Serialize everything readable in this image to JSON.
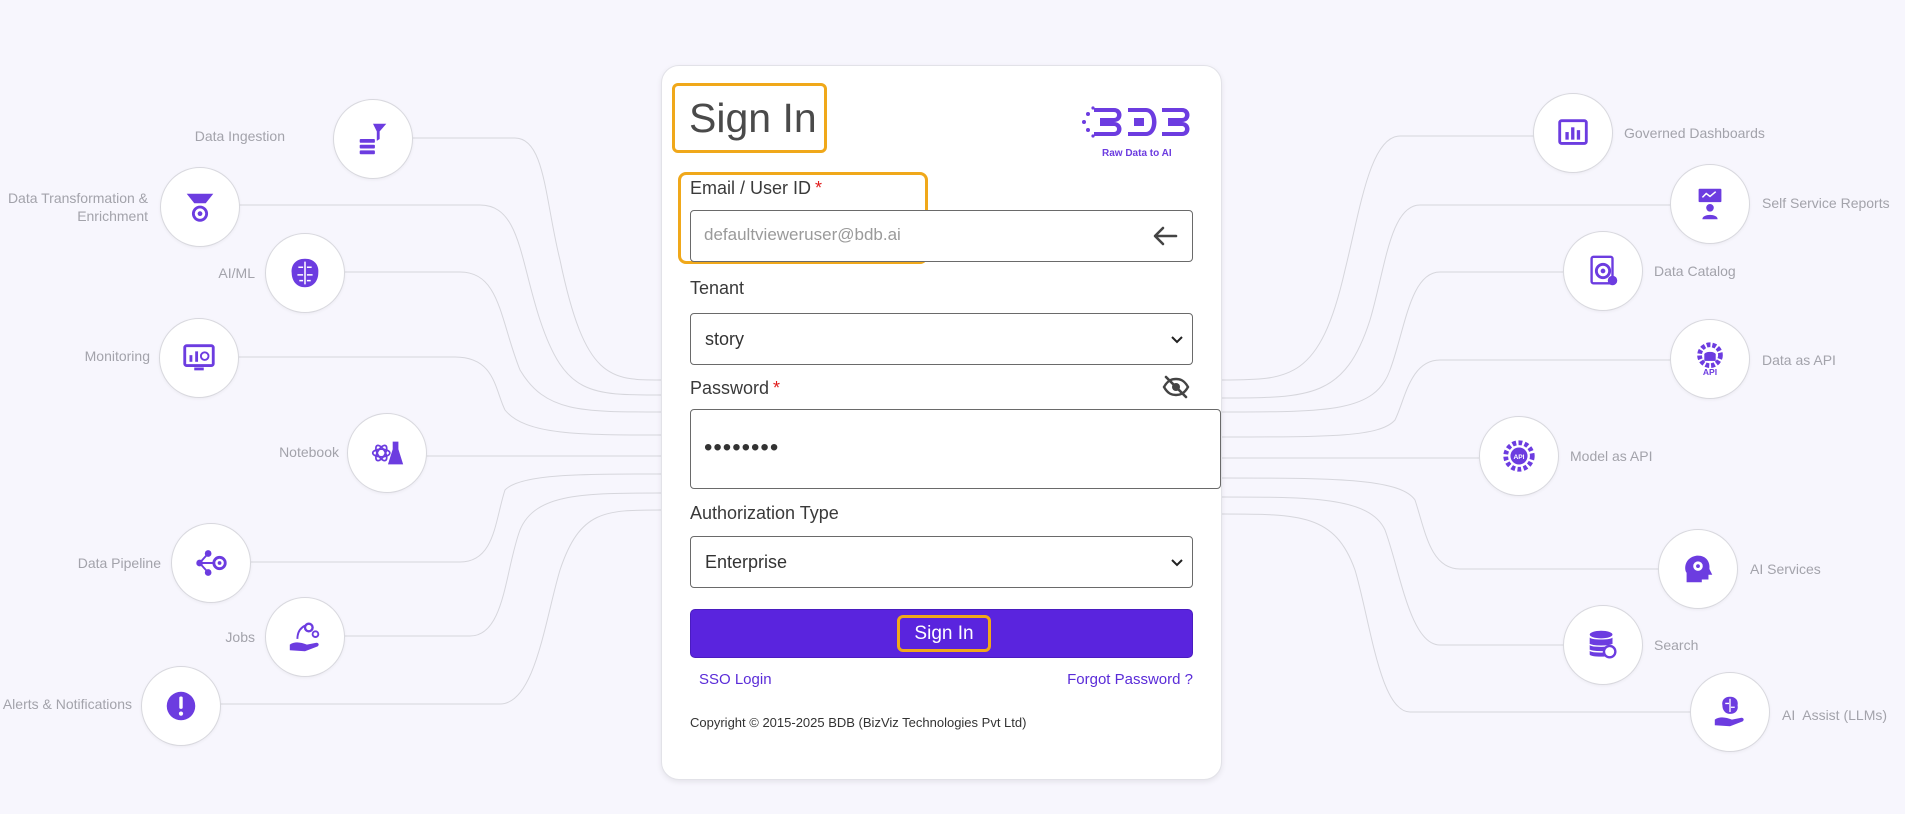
{
  "form": {
    "title": "Sign In",
    "logo_tagline": "Raw Data to AI",
    "email_label": "Email / User ID",
    "required_mark": "*",
    "email_value": "defaultvieweruser@bdb.ai",
    "tenant_label": "Tenant",
    "tenant_value": "story",
    "password_label": "Password",
    "password_value": "••••••••",
    "auth_label": "Authorization Type",
    "auth_value": "Enterprise",
    "signin_label": "Sign In",
    "sso_label": "SSO Login",
    "forgot_label": "Forgot Password ?",
    "copyright": "Copyright © 2015-2025 BDB (BizViz Technologies Pvt Ltd)"
  },
  "left_features": [
    {
      "label": "Data Ingestion",
      "icon": "funnel-database-icon"
    },
    {
      "label": "Data Transformation &",
      "label2": "Enrichment",
      "icon": "filter-gear-icon"
    },
    {
      "label": "AI/ML",
      "icon": "brain-circuit-icon"
    },
    {
      "label": "Monitoring",
      "icon": "monitor-chart-icon"
    },
    {
      "label": "Notebook",
      "icon": "atom-flask-icon"
    },
    {
      "label": "Data Pipeline",
      "icon": "pipeline-gear-icon"
    },
    {
      "label": "Jobs",
      "icon": "hand-gears-icon"
    },
    {
      "label": "Alerts & Notifications",
      "icon": "alert-icon"
    }
  ],
  "right_features": [
    {
      "label": "Governed Dashboards",
      "icon": "dashboard-icon"
    },
    {
      "label": "Self Service Reports",
      "icon": "presentation-user-icon"
    },
    {
      "label": "Data Catalog",
      "icon": "catalog-gear-icon"
    },
    {
      "label": "Data as API",
      "icon": "api-gear-icon"
    },
    {
      "label": "Model as API",
      "icon": "api-badge-icon"
    },
    {
      "label": "AI Services",
      "icon": "head-gear-icon"
    },
    {
      "label": "Search",
      "icon": "database-search-icon"
    },
    {
      "label": "AI  Assist (LLMs)",
      "icon": "hand-brain-icon"
    }
  ],
  "colors": {
    "accent": "#5a24de",
    "highlight": "#f0a81a",
    "icon": "#6c3ce0"
  }
}
